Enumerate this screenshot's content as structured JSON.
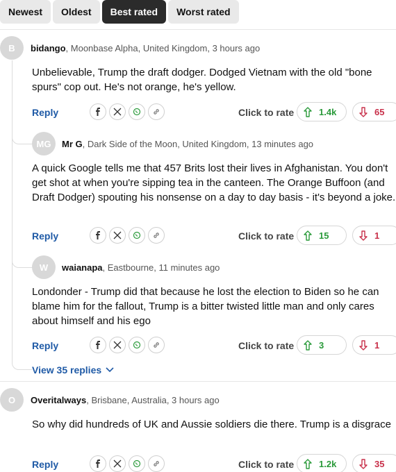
{
  "sort_tabs": [
    "Newest",
    "Oldest",
    "Best rated",
    "Worst rated"
  ],
  "active_sort": "Best rated",
  "rate_label": "Click to rate",
  "reply_label": "Reply",
  "share_icons": [
    "facebook-icon",
    "x-icon",
    "whatsapp-icon",
    "link-icon"
  ],
  "comments": [
    {
      "avatar_letter": "B",
      "username": "bidango",
      "location_time": ", Moonbase Alpha, United Kingdom, 3 hours ago",
      "text": "Unbelievable, Trump the draft dodger. Dodged Vietnam with the old \"bone spurs\" cop out. He's not orange, he's yellow.",
      "up": "1.4k",
      "down": "65"
    },
    {
      "avatar_letter": "MG",
      "username": "Mr G",
      "location_time": ", Dark Side of the Moon, United Kingdom, 13 minutes ago",
      "text": "A quick Google tells me that 457 Brits lost their lives in Afghanistan. You don't get shot at when you're sipping tea in the canteen. The Orange Buffoon (and Draft Dodger) spouting his nonsense on a day to day basis - it's beyond a joke.",
      "up": "15",
      "down": "1"
    },
    {
      "avatar_letter": "W",
      "username": "waianapa",
      "location_time": ", Eastbourne, 11 minutes ago",
      "text": "Londonder - Trump did that because he lost the election to Biden so he can blame him for the fallout, Trump is a bitter twisted little man and only cares about himself and his ego",
      "up": "3",
      "down": "1"
    },
    {
      "avatar_letter": "O",
      "username": "Overitalways",
      "location_time": ", Brisbane, Australia, 3 hours ago",
      "text": "So why did hundreds of UK and Aussie soldiers die there. Trump is a disgrace",
      "up": "1.2k",
      "down": "35"
    }
  ],
  "view_replies_label": "View 35 replies",
  "colors": {
    "active_tab": "#2b2b2b",
    "link": "#1f5aa6",
    "upvote": "#2a9a3a",
    "downvote": "#c8304a"
  }
}
